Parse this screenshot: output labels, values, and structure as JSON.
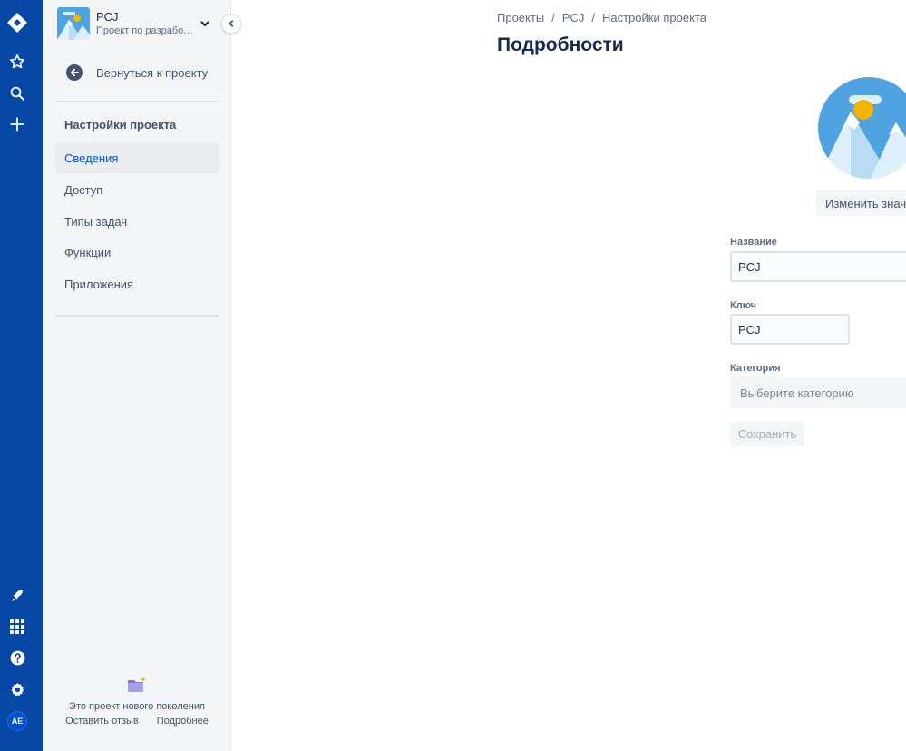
{
  "global_nav": {
    "avatar_initials": "AE",
    "icons": [
      "jira-logo-icon",
      "star-icon",
      "search-icon",
      "plus-icon",
      "rocket-icon",
      "apps-grid-icon",
      "help-icon",
      "settings-gear-icon"
    ]
  },
  "sidebar": {
    "project_name": "PCJ",
    "project_type": "Проект по разработке программного обеспечения",
    "back_label": "Вернуться к проекту",
    "section_title": "Настройки проекта",
    "items": [
      {
        "label": "Сведения",
        "active": true
      },
      {
        "label": "Доступ",
        "active": false
      },
      {
        "label": "Типы задач",
        "active": false
      },
      {
        "label": "Функции",
        "active": false
      },
      {
        "label": "Приложения",
        "active": false
      }
    ],
    "footer": {
      "note": "Это проект нового поколения",
      "feedback_label": "Оставить отзыв",
      "more_label": "Подробнее"
    }
  },
  "breadcrumbs": [
    "Проекты",
    "PCJ",
    "Настройки проекта"
  ],
  "breadcrumb_separator": "/",
  "page_title": "Подробности",
  "details_form": {
    "change_icon_label": "Изменить значок",
    "name_label": "Название",
    "name_value": "PCJ",
    "key_label": "Ключ",
    "key_value": "PCJ",
    "category_label": "Категория",
    "category_placeholder": "Выберите категорию",
    "save_label": "Сохранить"
  },
  "colors": {
    "nav_blue": "#0747A6",
    "sidebar_bg": "#F4F5F7",
    "active_link": "#0052CC",
    "text_primary": "#172B4D"
  }
}
